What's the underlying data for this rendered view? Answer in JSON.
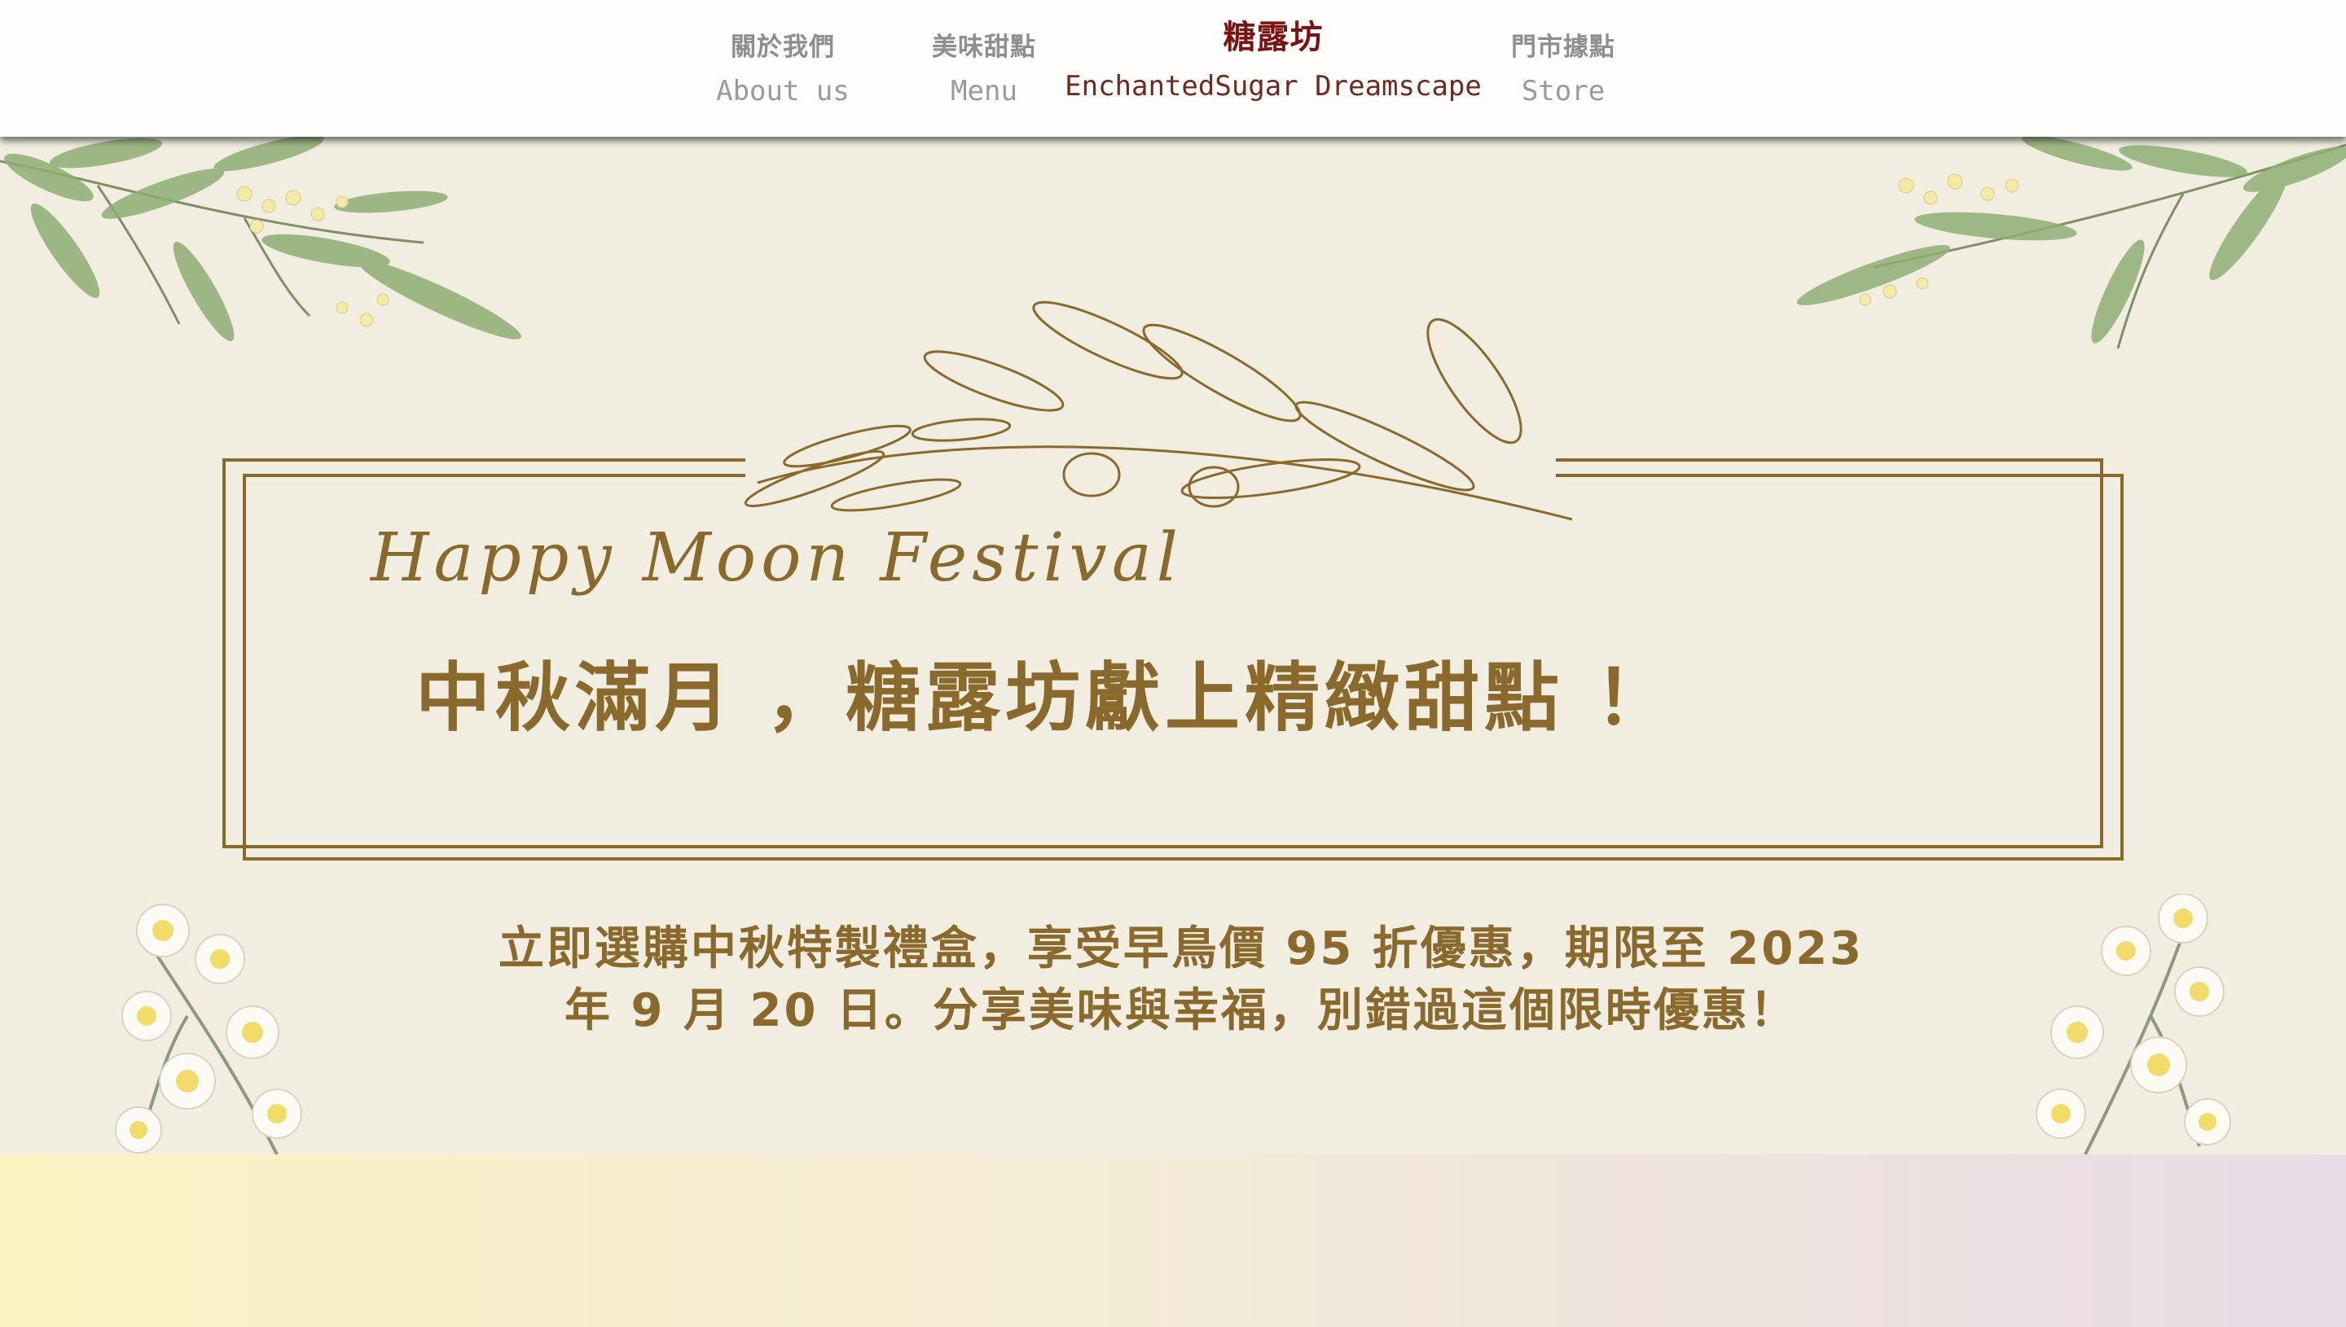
{
  "nav": {
    "items": [
      {
        "zh": "關於我們",
        "en": "About us"
      },
      {
        "zh": "美味甜點",
        "en": "Menu"
      },
      {
        "zh": "糖露坊",
        "en": "EnchantedSugar Dreamscape"
      },
      {
        "zh": "門市據點",
        "en": "Store"
      }
    ]
  },
  "hero": {
    "script_title": "Happy Moon Festival",
    "headline": "中秋滿月 ，糖露坊獻上精緻甜點 ！",
    "promo_line1": "立即選購中秋特製禮盒，享受早鳥價 95 折優惠，期限至 2023",
    "promo_line2": "年 9 月 20 日。分享美味與幸福，別錯過這個限時優惠！"
  },
  "colors": {
    "background": "#f2ede1",
    "gold": "#8a6a2c",
    "brand": "#7a1414",
    "nav_text": "#8e8e8e"
  },
  "icons": [
    "eucalyptus-branch-icon",
    "olive-branch-icon",
    "flower-cluster-icon"
  ]
}
